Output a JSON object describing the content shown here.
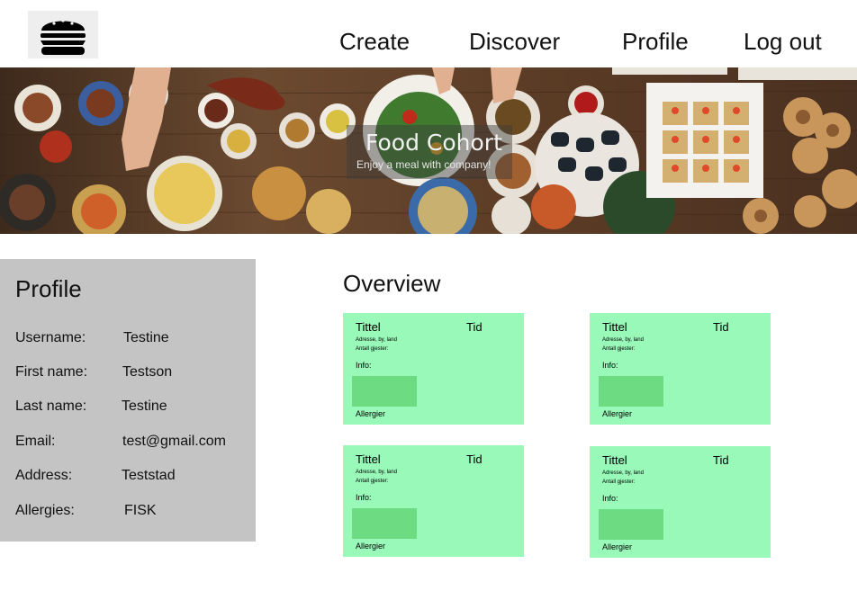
{
  "header": {
    "logo_icon": "burger-icon",
    "nav": {
      "create": "Create",
      "discover": "Discover",
      "profile": "Profile",
      "logout": "Log out"
    }
  },
  "banner": {
    "title": "Food Cohort",
    "subtitle": "Enjoy a meal with company!"
  },
  "profile": {
    "title": "Profile",
    "fields": [
      {
        "label": "Username:",
        "value": "Testine"
      },
      {
        "label": "First name:",
        "value": "Testson"
      },
      {
        "label": "Last name:",
        "value": "Testine"
      },
      {
        "label": "Email:",
        "value": "test@gmail.com"
      },
      {
        "label": "Address:",
        "value": "Teststad"
      },
      {
        "label": "Allergies:",
        "value": "FISK"
      }
    ]
  },
  "overview": {
    "title": "Overview",
    "cards": [
      {
        "title": "Tittel",
        "time": "Tid",
        "address": "Adresse, by, land",
        "guests": "Antall gjester:",
        "info": "Info:",
        "allergies": "Allergier"
      },
      {
        "title": "Tittel",
        "time": "Tid",
        "address": "Adresse, by, land",
        "guests": "Antall gjester:",
        "info": "Info:",
        "allergies": "Allergier"
      },
      {
        "title": "Tittel",
        "time": "Tid",
        "address": "Adresse, by, land",
        "guests": "Antall gjester:",
        "info": "Info:",
        "allergies": "Allergier"
      },
      {
        "title": "Tittel",
        "time": "Tid",
        "address": "Adresse, by, land",
        "guests": "Antall gjester:",
        "info": "Info:",
        "allergies": "Allergier"
      }
    ]
  },
  "colors": {
    "card_bg": "#98f9b9",
    "card_image": "#6cdb82",
    "profile_panel": "#c4c4c4"
  }
}
